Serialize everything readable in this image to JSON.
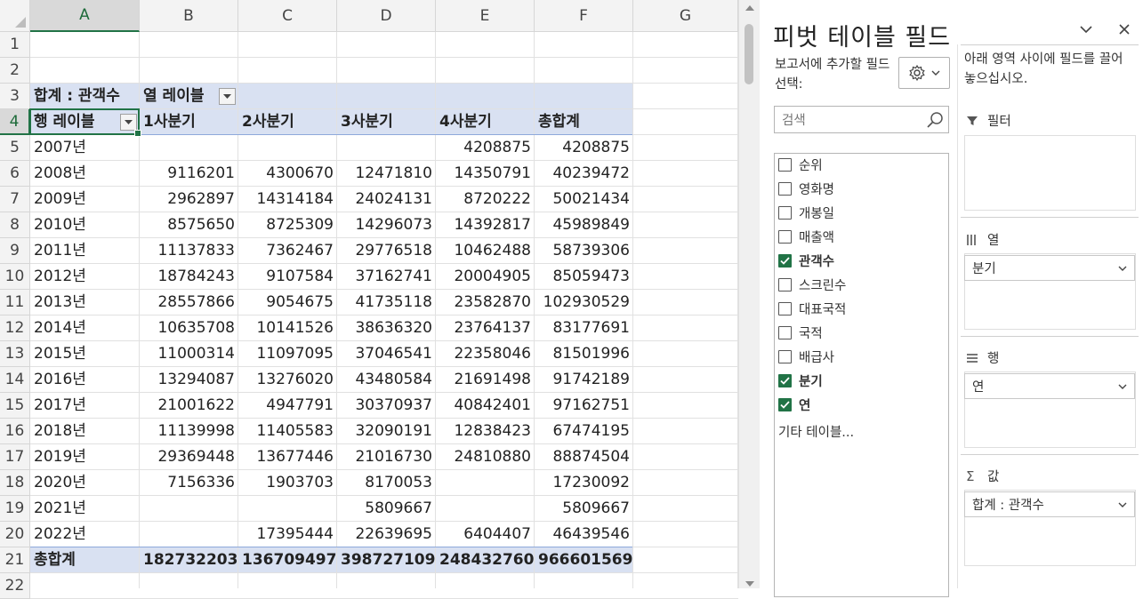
{
  "columns": [
    "A",
    "B",
    "C",
    "D",
    "E",
    "F",
    "G"
  ],
  "rows": [
    "1",
    "2",
    "3",
    "4",
    "5",
    "6",
    "7",
    "8",
    "9",
    "10",
    "11",
    "12",
    "13",
    "14",
    "15",
    "16",
    "17",
    "18",
    "19",
    "20",
    "21",
    "22"
  ],
  "pivot": {
    "sum_label": "합계 : 관객수",
    "col_label": "열 레이블",
    "row_label": "행 레이블",
    "quarters": [
      "1사분기",
      "2사분기",
      "3사분기",
      "4사분기",
      "총합계"
    ],
    "data": [
      [
        "2007년",
        "",
        "",
        "",
        "4208875",
        "4208875"
      ],
      [
        "2008년",
        "9116201",
        "4300670",
        "12471810",
        "14350791",
        "40239472"
      ],
      [
        "2009년",
        "2962897",
        "14314184",
        "24024131",
        "8720222",
        "50021434"
      ],
      [
        "2010년",
        "8575650",
        "8725309",
        "14296073",
        "14392817",
        "45989849"
      ],
      [
        "2011년",
        "11137833",
        "7362467",
        "29776518",
        "10462488",
        "58739306"
      ],
      [
        "2012년",
        "18784243",
        "9107584",
        "37162741",
        "20004905",
        "85059473"
      ],
      [
        "2013년",
        "28557866",
        "9054675",
        "41735118",
        "23582870",
        "102930529"
      ],
      [
        "2014년",
        "10635708",
        "10141526",
        "38636320",
        "23764137",
        "83177691"
      ],
      [
        "2015년",
        "11000314",
        "11097095",
        "37046541",
        "22358046",
        "81501996"
      ],
      [
        "2016년",
        "13294087",
        "13276020",
        "43480584",
        "21691498",
        "91742189"
      ],
      [
        "2017년",
        "21001622",
        "4947791",
        "30370937",
        "40842401",
        "97162751"
      ],
      [
        "2018년",
        "11139998",
        "11405583",
        "32090191",
        "12838423",
        "67474195"
      ],
      [
        "2019년",
        "29369448",
        "13677446",
        "21016730",
        "24810880",
        "88874504"
      ],
      [
        "2020년",
        "7156336",
        "1903703",
        "8170053",
        "",
        "17230092"
      ],
      [
        "2021년",
        "",
        "",
        "5809667",
        "",
        "5809667"
      ],
      [
        "2022년",
        "",
        "17395444",
        "22639695",
        "6404407",
        "46439546"
      ]
    ],
    "total_row": [
      "총합계",
      "182732203",
      "136709497",
      "398727109",
      "248432760",
      "966601569"
    ]
  },
  "pane": {
    "title": "피벗 테이블 필드",
    "choose_label": "보고서에 추가할 필드 선택:",
    "drag_hint": "아래 영역 사이에 필드를 끌어 놓으십시오.",
    "search_placeholder": "검색",
    "fields": [
      {
        "name": "순위",
        "checked": false
      },
      {
        "name": "영화명",
        "checked": false
      },
      {
        "name": "개봉일",
        "checked": false
      },
      {
        "name": "매출액",
        "checked": false
      },
      {
        "name": "관객수",
        "checked": true
      },
      {
        "name": "스크린수",
        "checked": false
      },
      {
        "name": "대표국적",
        "checked": false
      },
      {
        "name": "국적",
        "checked": false
      },
      {
        "name": "배급사",
        "checked": false
      },
      {
        "name": "분기",
        "checked": true
      },
      {
        "name": "연",
        "checked": true
      }
    ],
    "more_tables": "기타 테이블...",
    "areas": {
      "filter": "필터",
      "columns": "열",
      "rows": "행",
      "values": "값",
      "columns_item": "분기",
      "rows_item": "연",
      "values_item": "합계 : 관객수"
    },
    "icons": [
      "gear-icon",
      "search-icon",
      "chevron-down-icon",
      "close-icon",
      "filter-icon",
      "columns-icon",
      "rows-icon",
      "sigma-icon"
    ]
  },
  "colors": {
    "accent": "#217346",
    "pivot_band": "#d9e1f2"
  }
}
